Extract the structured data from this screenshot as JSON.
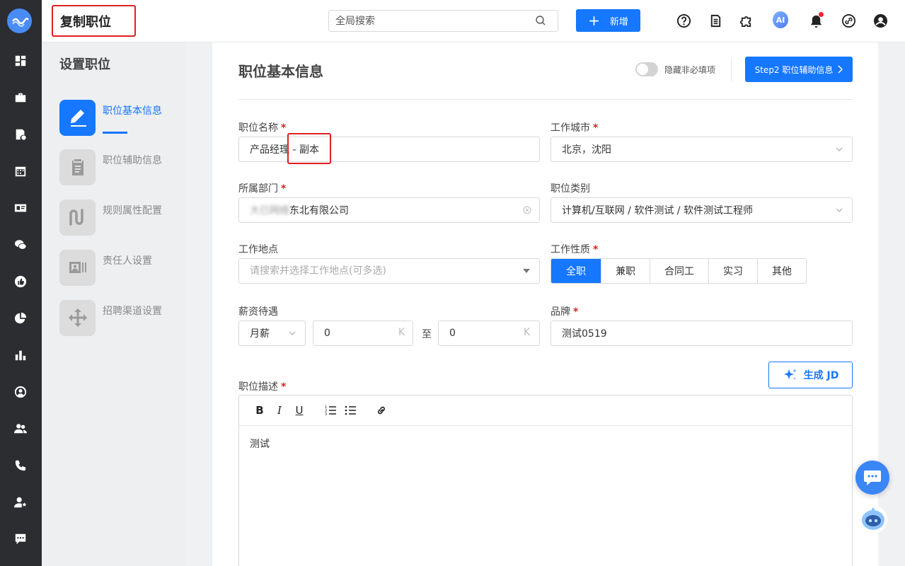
{
  "header": {
    "page_title": "复制职位",
    "search_placeholder": "全局搜索",
    "new_button": "新增"
  },
  "steps": {
    "title": "设置职位",
    "items": [
      {
        "label": "职位基本信息",
        "icon": "pencil-icon",
        "active": true
      },
      {
        "label": "职位辅助信息",
        "icon": "clipboard-icon",
        "active": false
      },
      {
        "label": "规则属性配置",
        "icon": "squiggle-icon",
        "active": false
      },
      {
        "label": "责任人设置",
        "icon": "id-card-icon",
        "active": false
      },
      {
        "label": "招聘渠道设置",
        "icon": "move-arrows-icon",
        "active": false
      }
    ]
  },
  "form": {
    "title": "职位基本信息",
    "toggle_label": "隐藏非必填项",
    "step2_button": "Step2 职位辅助信息",
    "job_name_label": "职位名称",
    "job_name_value": "产品经理 - 副本",
    "city_label": "工作城市",
    "city_value": "北京，沈阳",
    "dept_label": "所属部门",
    "dept_value_blurred": "大已网络",
    "dept_value_rest": "东北有限公司",
    "category_label": "职位类别",
    "category_value": "计算机/互联网 / 软件测试 / 软件测试工程师",
    "location_label": "工作地点",
    "location_placeholder": "请搜索并选择工作地点(可多选)",
    "nature_label": "工作性质",
    "nature_options": [
      "全职",
      "兼职",
      "合同工",
      "实习",
      "其他"
    ],
    "salary_label": "薪资待遇",
    "salary_type": "月薪",
    "salary_min": "0",
    "salary_max": "0",
    "salary_unit": "K",
    "salary_to": "至",
    "brand_label": "品牌",
    "brand_value": "测试0519",
    "jd_button": "生成 JD",
    "desc_label": "职位描述",
    "desc_value": "测试",
    "required_mark": "*"
  },
  "colors": {
    "accent": "#1677ff",
    "required": "#e02020",
    "highlight": "#e02020"
  }
}
